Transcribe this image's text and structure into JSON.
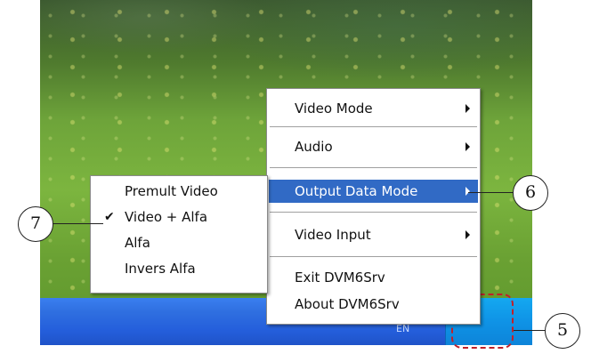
{
  "main_menu": {
    "items": [
      {
        "label": "Video Mode",
        "submenu": true
      },
      {
        "label": "Audio",
        "submenu": true
      },
      {
        "label": "Output Data Mode",
        "submenu": true,
        "selected": true
      },
      {
        "label": "Video Input",
        "submenu": true
      },
      {
        "label": "Exit DVM6Srv",
        "submenu": false
      },
      {
        "label": "About DVM6Srv",
        "submenu": false
      }
    ]
  },
  "output_data_mode_submenu": {
    "items": [
      {
        "label": "Premult Video",
        "checked": false
      },
      {
        "label": "Video + Alfa",
        "checked": true
      },
      {
        "label": "Alfa",
        "checked": false
      },
      {
        "label": "Invers Alfa",
        "checked": false
      }
    ],
    "check_glyph": "✔"
  },
  "taskbar": {
    "language_indicator": "EN",
    "tray_icon": "dvm6srv-tray-icon",
    "color": "#245edb",
    "tray_color": "#0f93e6"
  },
  "callouts": {
    "five": "5",
    "six": "6",
    "seven": "7"
  },
  "colors": {
    "menu_highlight": "#316ac5",
    "callout_box": "#c0202a"
  }
}
